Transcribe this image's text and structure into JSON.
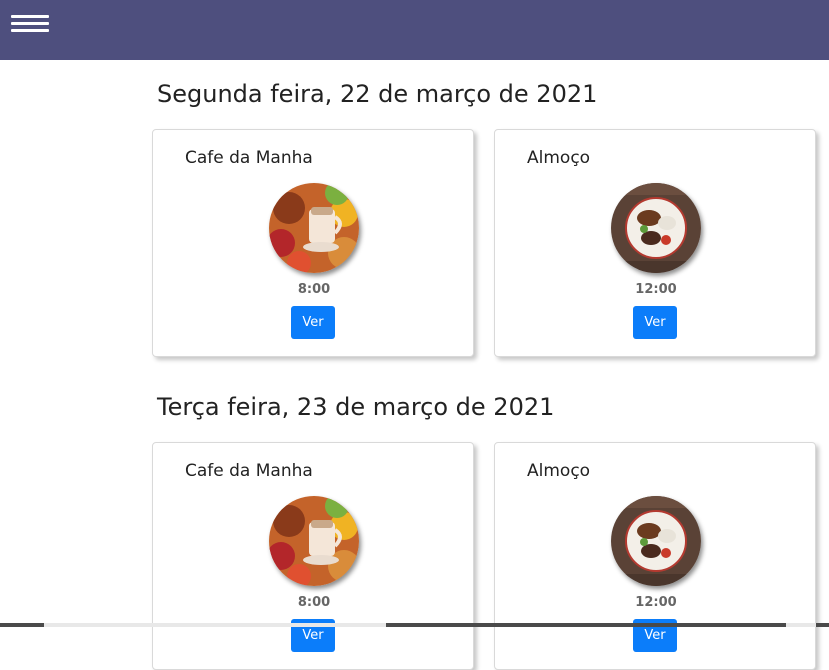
{
  "header": {
    "menu_icon": "hamburger-menu-icon",
    "background_color": "#4e4f7e"
  },
  "days": [
    {
      "title": "Segunda feira, 22 de março de 2021",
      "meals": [
        {
          "name": "Cafe da Manha",
          "time": "8:00",
          "button_label": "Ver",
          "image": "breakfast-photo"
        },
        {
          "name": "Almoço",
          "time": "12:00",
          "button_label": "Ver",
          "image": "lunch-plate-photo"
        }
      ]
    },
    {
      "title": "Terça feira, 23 de março de 2021",
      "meals": [
        {
          "name": "Cafe da Manha",
          "time": "8:00",
          "button_label": "Ver",
          "image": "breakfast-photo"
        },
        {
          "name": "Almoço",
          "time": "12:00",
          "button_label": "Ver",
          "image": "lunch-plate-photo"
        }
      ]
    }
  ],
  "colors": {
    "button": "#0b7dfa",
    "button_text": "#ffffff"
  }
}
